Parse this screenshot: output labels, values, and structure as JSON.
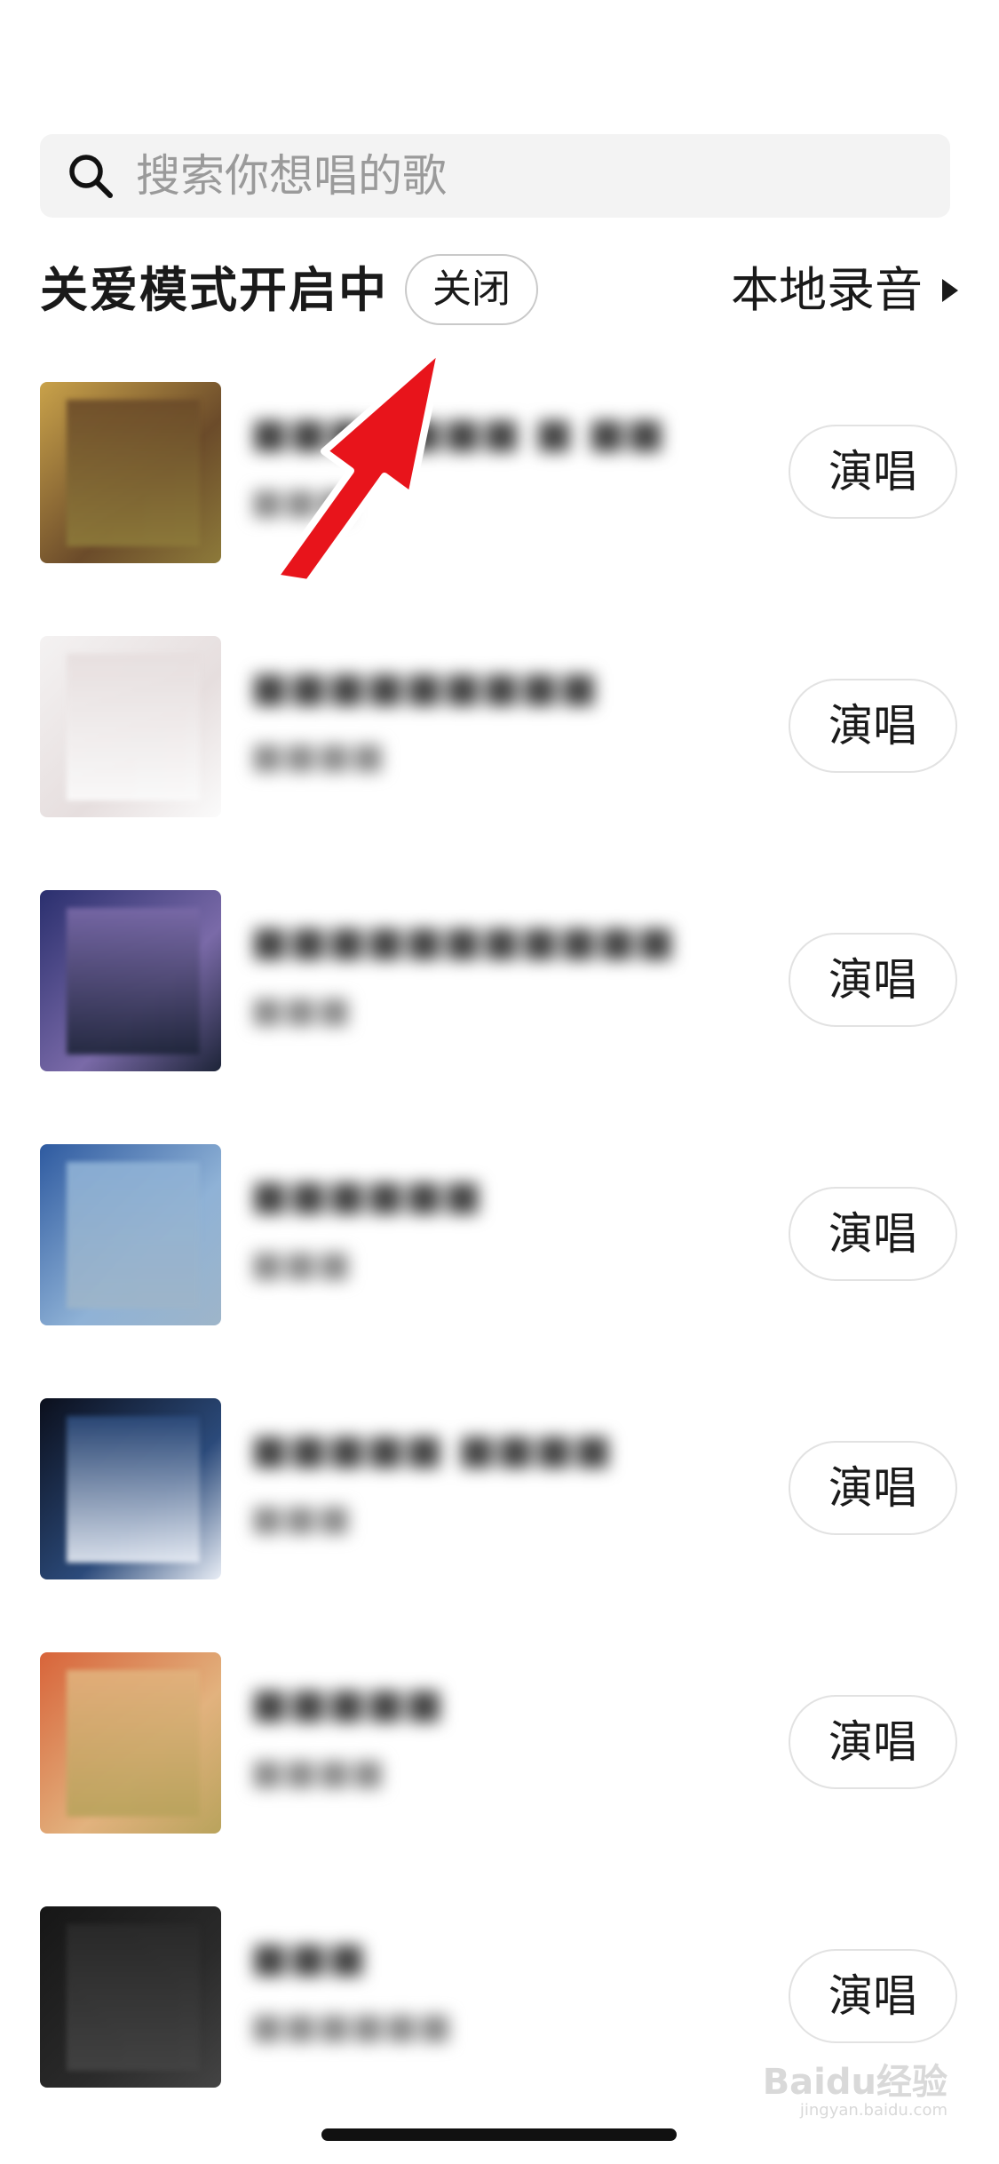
{
  "search": {
    "placeholder": "搜索你想唱的歌"
  },
  "care_mode": {
    "title": "关爱模式开启中",
    "close_label": "关闭"
  },
  "local_recording": {
    "label": "本地录音"
  },
  "songs": [
    {
      "title": "■■■■■■■ ■ ■■",
      "artist": "■■■",
      "sing_label": "演唱",
      "cover_colors": [
        "#c9a24a",
        "#6b4b2a",
        "#8d7a3a"
      ]
    },
    {
      "title": "■■■■■■■■■",
      "artist": "■■■■",
      "sing_label": "演唱",
      "cover_colors": [
        "#f4f2f2",
        "#e6dede",
        "#fbfbfb"
      ]
    },
    {
      "title": "■■■■■■■■■■■",
      "artist": "■■■",
      "sing_label": "演唱",
      "cover_colors": [
        "#2a2f6e",
        "#7a6aa8",
        "#1d2438"
      ]
    },
    {
      "title": "■■■■■■",
      "artist": "■■■",
      "sing_label": "演唱",
      "cover_colors": [
        "#2e5aa0",
        "#8fb2d6",
        "#9eb5c9"
      ]
    },
    {
      "title": "■■■■■ ■■■■",
      "artist": "■■■",
      "sing_label": "演唱",
      "cover_colors": [
        "#0b0f1c",
        "#2b4a7a",
        "#e9eef6"
      ]
    },
    {
      "title": "■■■■■",
      "artist": "■■■■",
      "sing_label": "演唱",
      "cover_colors": [
        "#d8643a",
        "#e2b27e",
        "#b9a35c"
      ]
    },
    {
      "title": "■■■",
      "artist": "■■■■■■",
      "sing_label": "演唱",
      "cover_colors": [
        "#161616",
        "#2a2a2a",
        "#444444"
      ]
    }
  ],
  "watermark": {
    "text": "Baidu经验",
    "sub": "jingyan.baidu.com"
  },
  "colors": {
    "accent_arrow": "#e8141b",
    "search_bg": "#f3f3f3"
  }
}
